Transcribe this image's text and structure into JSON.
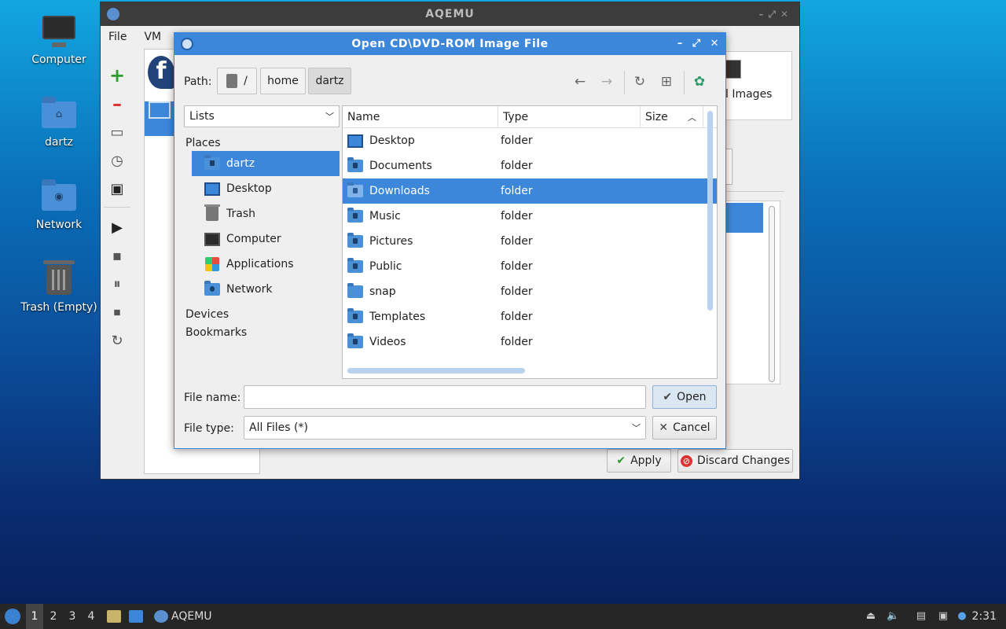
{
  "desktop": {
    "icons": [
      {
        "label": "Computer",
        "icon": "computer-icon"
      },
      {
        "label": "dartz",
        "icon": "home-folder-icon"
      },
      {
        "label": "Network",
        "icon": "network-folder-icon"
      },
      {
        "label": "Trash (Empty)",
        "icon": "trash-icon"
      }
    ]
  },
  "main_window": {
    "title": "AQEMU",
    "menu": [
      "File",
      "VM"
    ],
    "panel_label": "l Images",
    "apply_label": "Apply",
    "discard_label": "Discard Changes"
  },
  "dialog": {
    "title": "Open CD\\DVD-ROM Image File",
    "path_label": "Path:",
    "crumbs": [
      "/",
      "home",
      "dartz"
    ],
    "places_view": "Lists",
    "groups": [
      "Places",
      "Devices",
      "Bookmarks"
    ],
    "places": [
      {
        "label": "dartz",
        "icon": "home-folder-icon",
        "selected": true
      },
      {
        "label": "Desktop",
        "icon": "desktop-icon"
      },
      {
        "label": "Trash",
        "icon": "trash-icon"
      },
      {
        "label": "Computer",
        "icon": "computer-icon"
      },
      {
        "label": "Applications",
        "icon": "applications-icon"
      },
      {
        "label": "Network",
        "icon": "network-folder-icon"
      }
    ],
    "columns": [
      "Name",
      "Type",
      "Size"
    ],
    "files": [
      {
        "name": "Desktop",
        "type": "folder"
      },
      {
        "name": "Documents",
        "type": "folder"
      },
      {
        "name": "Downloads",
        "type": "folder",
        "selected": true
      },
      {
        "name": "Music",
        "type": "folder"
      },
      {
        "name": "Pictures",
        "type": "folder"
      },
      {
        "name": "Public",
        "type": "folder"
      },
      {
        "name": "snap",
        "type": "folder"
      },
      {
        "name": "Templates",
        "type": "folder"
      },
      {
        "name": "Videos",
        "type": "folder"
      }
    ],
    "file_name_label": "File name:",
    "file_name_value": "",
    "file_type_label": "File type:",
    "file_type_value": "All Files (*)",
    "open_label": "Open",
    "cancel_label": "Cancel"
  },
  "taskbar": {
    "workspaces": [
      "1",
      "2",
      "3",
      "4"
    ],
    "app_label": "AQEMU",
    "clock": "2:31"
  },
  "colors": {
    "selection": "#3d87db",
    "dialog_title": "#3d87db",
    "main_title": "#3c3c3c",
    "taskbar": "#262626"
  }
}
